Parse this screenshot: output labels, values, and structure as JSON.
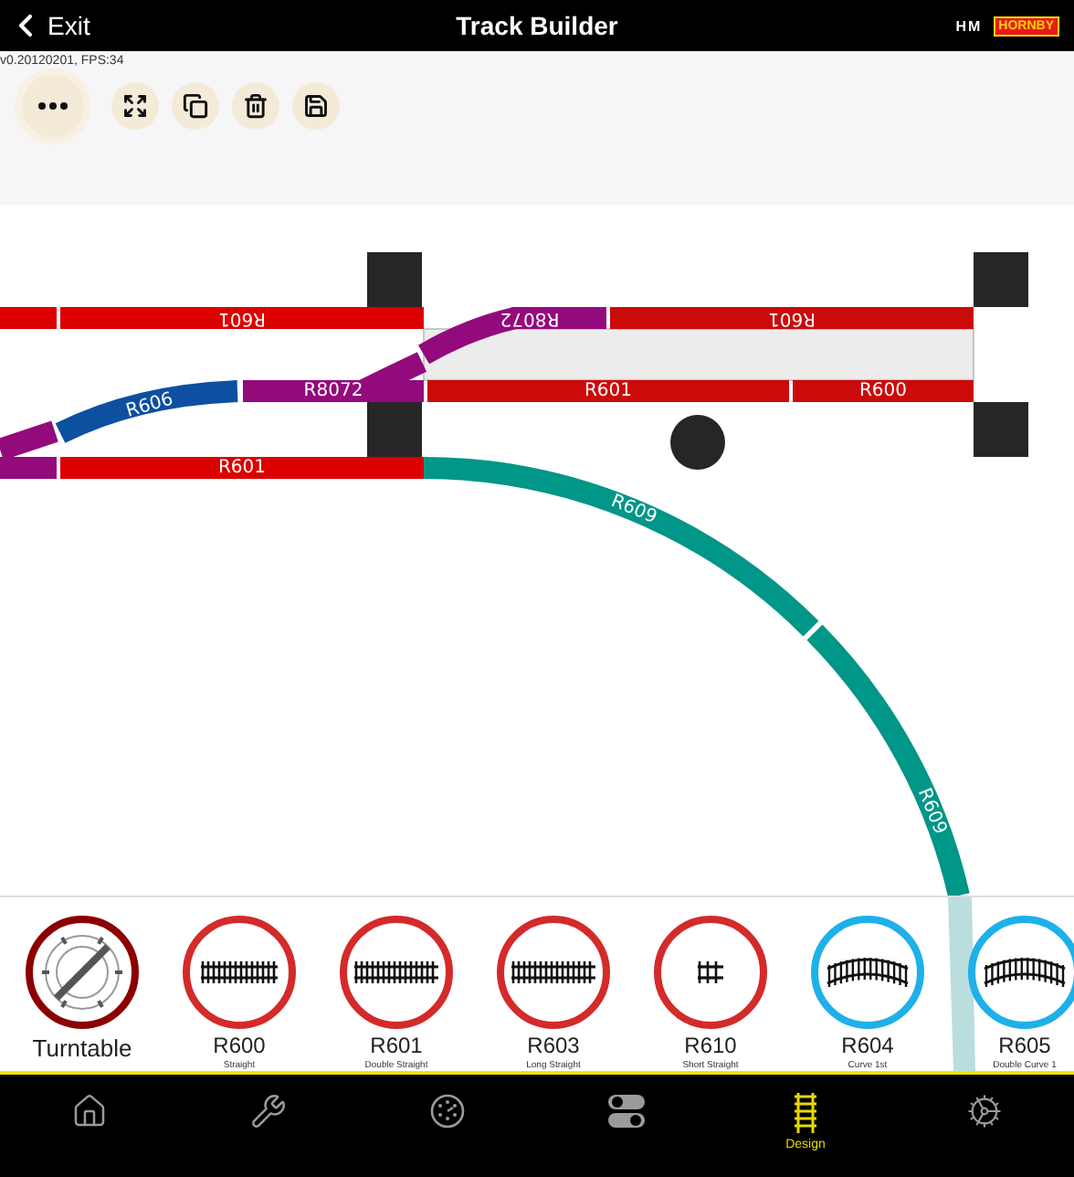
{
  "header": {
    "back": "Exit",
    "title": "Track Builder",
    "logos": [
      {
        "kind": "hm",
        "text": "HM"
      },
      {
        "kind": "hornby",
        "text": "HORNBY"
      }
    ]
  },
  "version": "v0.20120201, FPS:34",
  "toolbar": [
    {
      "kind": "more"
    },
    {
      "kind": "fit"
    },
    {
      "kind": "copy"
    },
    {
      "kind": "delete"
    },
    {
      "kind": "save"
    }
  ],
  "layout_tracks": [
    {
      "color": "#dd0000"
    },
    {
      "label": "R601",
      "color": "#dd0000",
      "flipped": true
    },
    {
      "label": "R8072",
      "color": "#930a7d",
      "flipped": true
    },
    {
      "label": "R601",
      "color": "#cc0a0a",
      "flipped": true
    },
    {
      "label": "R606",
      "color": "#0d50a0",
      "flipped": false
    },
    {
      "label": "R8072",
      "color": "#930a7d",
      "flipped": false
    },
    {
      "label": "R601",
      "color": "#cc0a0a",
      "flipped": false
    },
    {
      "label": "R600",
      "color": "#cc0a0a",
      "flipped": false
    },
    {
      "color": "#930a7d"
    },
    {
      "label": "R601",
      "color": "#dd0000",
      "flipped": false
    },
    {
      "label": "R609",
      "color": "#009688",
      "flipped": false
    },
    {
      "label": "R609",
      "color": "#009688",
      "flipped": false
    }
  ],
  "palette": [
    {
      "kind": "turntable",
      "code": "Turntable",
      "color": "#8b0000"
    },
    {
      "kind": "straight",
      "code": "R600",
      "name": "Straight",
      "color": "#d42a2a"
    },
    {
      "kind": "double",
      "code": "R601",
      "name": "Double Straight",
      "color": "#d42a2a"
    },
    {
      "kind": "long",
      "code": "R603",
      "name": "Long Straight",
      "color": "#d42a2a"
    },
    {
      "kind": "short",
      "code": "R610",
      "name": "Short Straight",
      "color": "#d42a2a"
    },
    {
      "kind": "curve",
      "code": "R604",
      "name": "Curve 1st",
      "color": "#1eb0ea"
    },
    {
      "kind": "curve",
      "code": "R605",
      "name": "Double Curve 1",
      "color": "#1eb0ea"
    }
  ],
  "nav": [
    {
      "kind": "home",
      "selected": false
    },
    {
      "kind": "tools",
      "selected": false
    },
    {
      "kind": "gauge",
      "selected": false
    },
    {
      "kind": "toggles",
      "selected": false
    },
    {
      "kind": "design",
      "label": "Design",
      "selected": true
    },
    {
      "kind": "settings",
      "selected": false
    }
  ]
}
